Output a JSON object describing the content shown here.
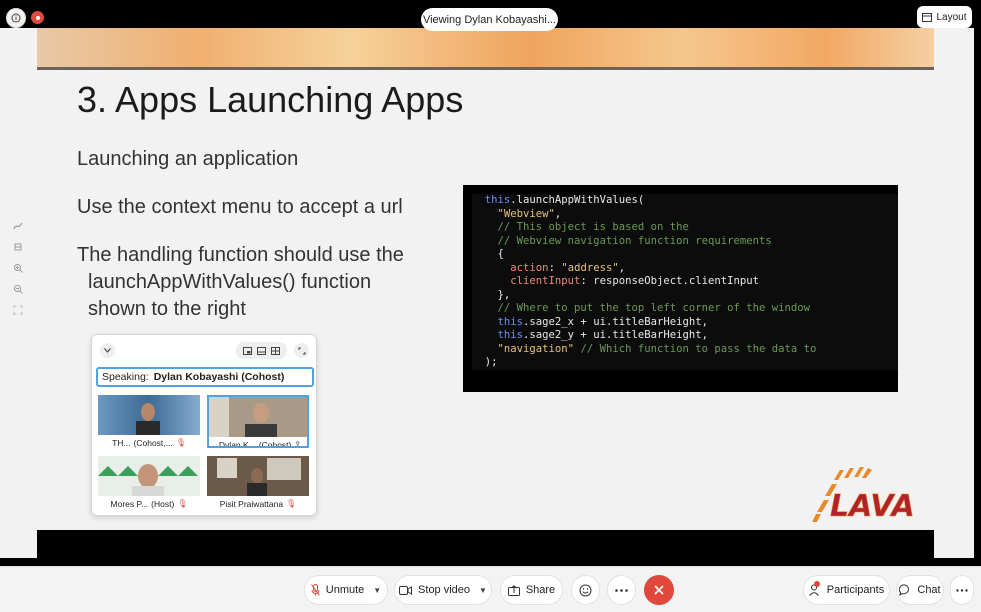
{
  "topbar": {
    "viewing": "Viewing Dylan Kobayashi...",
    "layout_label": "Layout"
  },
  "slide": {
    "title": "3. Apps Launching Apps",
    "bullets": [
      "Launching an application",
      "Use the context menu to accept a url",
      "The handling function should use the",
      "launchAppWithValues() function",
      "shown to the right"
    ],
    "code": [
      "this.launchAppWithValues(",
      "  \"Webview\",",
      "  // This object is based on the",
      "  // Webview navigation function requirements",
      "  {",
      "    action: \"address\",",
      "    clientInput: responseObject.clientInput",
      "  },",
      "  // Where to put the top left corner of the window",
      "  this.sage2_x + ui.titleBarHeight,",
      "  this.sage2_y + ui.titleBarHeight,",
      "  \"navigation\" // Which function to pass the data to",
      ");"
    ],
    "logo_text": "LAVA"
  },
  "video_panel": {
    "speaking_label": "Speaking:",
    "speaking_name": "Dylan Kobayashi (Cohost)",
    "tiles": [
      {
        "name": "TH...",
        "role": "(Cohost,..."
      },
      {
        "name": "Dylan K...",
        "role": "(Cohost)"
      },
      {
        "name": "Mores P...",
        "role": "(Host)"
      },
      {
        "name": "Pisit Praiwattana",
        "role": ""
      }
    ]
  },
  "controls": {
    "unmute": "Unmute",
    "stop_video": "Stop video",
    "share": "Share",
    "participants": "Participants",
    "chat": "Chat"
  },
  "colors": {
    "end_call": "#e0483d",
    "speaker_highlight": "#4ca3e0"
  }
}
